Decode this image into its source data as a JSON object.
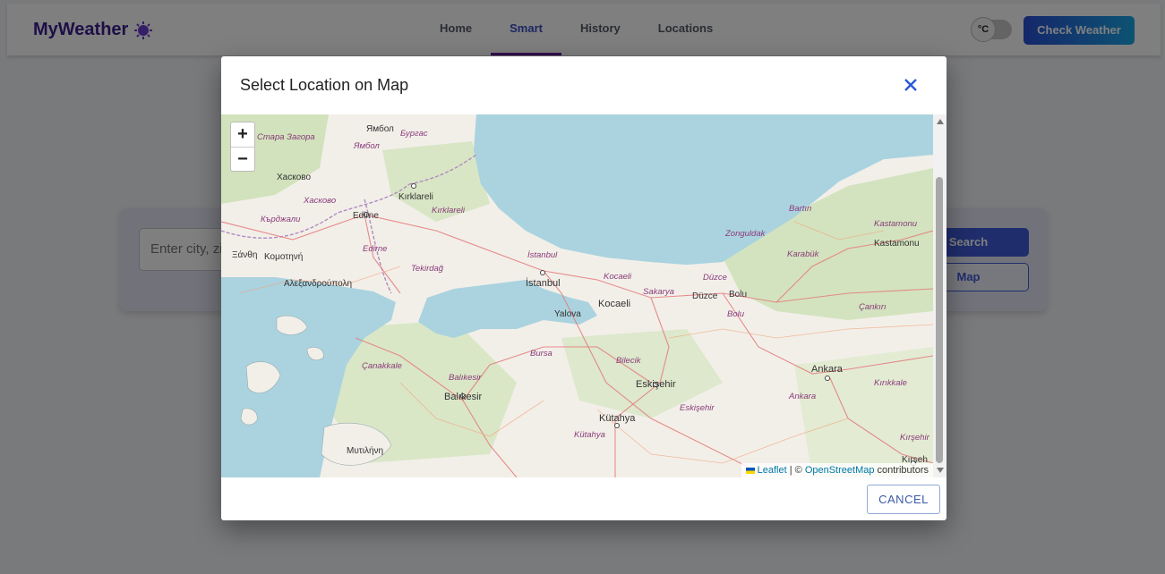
{
  "app": {
    "title": "MyWeather",
    "brand_color": "#3b1f8f"
  },
  "nav": {
    "items": [
      {
        "label": "Home",
        "active": false
      },
      {
        "label": "Smart",
        "active": true
      },
      {
        "label": "History",
        "active": false
      },
      {
        "label": "Locations",
        "active": false
      }
    ]
  },
  "unit_toggle": {
    "label": "°C"
  },
  "header": {
    "check_weather_label": "Check Weather"
  },
  "search": {
    "placeholder": "Enter city, zi",
    "search_label": "Search",
    "map_label": "Map"
  },
  "dialog": {
    "title": "Select Location on Map",
    "cancel_label": "CANCEL",
    "close_icon": "close-icon"
  },
  "map": {
    "zoom_in_label": "+",
    "zoom_out_label": "−",
    "attribution": {
      "leaflet": "Leaflet",
      "separator": " | © ",
      "osm": "OpenStreetMap",
      "suffix": " contributors"
    },
    "places": {
      "stara_zagora": "Стара Загора",
      "yambol_a": "Ямбол",
      "yambol_b": "Ямбол",
      "burgas": "Бургас",
      "haskovo_a": "Хасково",
      "haskovo_b": "Хасково",
      "kardzhali": "Кърджали",
      "kirklareli_a": "Kırklareli",
      "kirklareli_b": "Kırklareli",
      "edirne_a": "Edirne",
      "edirne_b": "Edirne",
      "xanthi": "Ξάνθη",
      "komotini": "Κομοτηνή",
      "alexandroupoli": "Αλεξανδρούπολη",
      "tekirdag": "Tekirdağ",
      "istanbul_a": "İstanbul",
      "istanbul_b": "İstanbul",
      "kocaeli_a": "Kocaeli",
      "kocaeli_b": "Kocaeli",
      "yalova": "Yalova",
      "sakarya": "Sakarya",
      "duzce_a": "Düzce",
      "duzce_b": "Düzce",
      "bolu_a": "Bolu",
      "bolu_b": "Bolu",
      "zonguldak": "Zonguldak",
      "bartin": "Bartın",
      "karabuk": "Karabük",
      "kastamonu_a": "Kastamonu",
      "kastamonu_b": "Kastamonu",
      "cankiri": "Çankırı",
      "canakkale": "Çanakkale",
      "balikesir_a": "Balıkesir",
      "balikesir_b": "Balıkesir",
      "bursa": "Bursa",
      "bilecik": "Bilecik",
      "eskisehir_a": "Eskişehir",
      "eskisehir_b": "Eskişehir",
      "kutahya_a": "Kütahya",
      "kutahya_b": "Kütahya",
      "ankara_a": "Ankara",
      "ankara_b": "Ankara",
      "kirikkale": "Kırıkkale",
      "kirsehir_a": "Kırşehir",
      "kirsehir_b": "Kırşeh",
      "mytilene": "Μυτιλήνη"
    }
  }
}
